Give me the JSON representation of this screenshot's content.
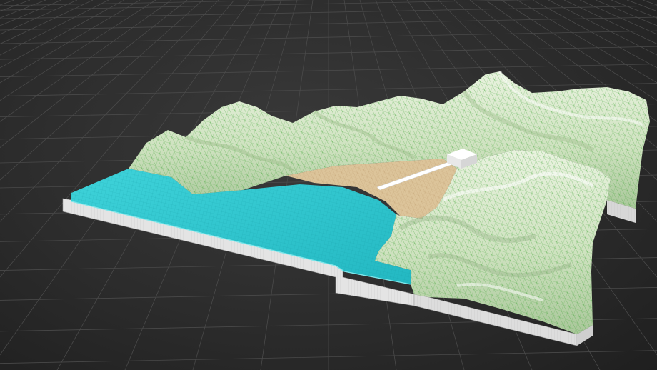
{
  "scene": {
    "type": "3d-terrain-viewport",
    "colors": {
      "background": "#2c2c2c",
      "grid_line": "#4a4a4a",
      "water": "#2ec7d0",
      "water_edge": "#7fe6ea",
      "sand": "#dcc49a",
      "terrain": "#dbe9cf",
      "terrain_shadow": "#8fae80",
      "wireframe": "#3fa535",
      "base_wall": "#e6e6e6",
      "structure": "#ffffff"
    },
    "elements": {
      "terrain": "mountain-terrain-mesh",
      "water": "bay-water-mesh",
      "beach": "sand-beach",
      "pier": "pier-structure",
      "building": "small-building",
      "base": "terrain-base-slab"
    }
  }
}
